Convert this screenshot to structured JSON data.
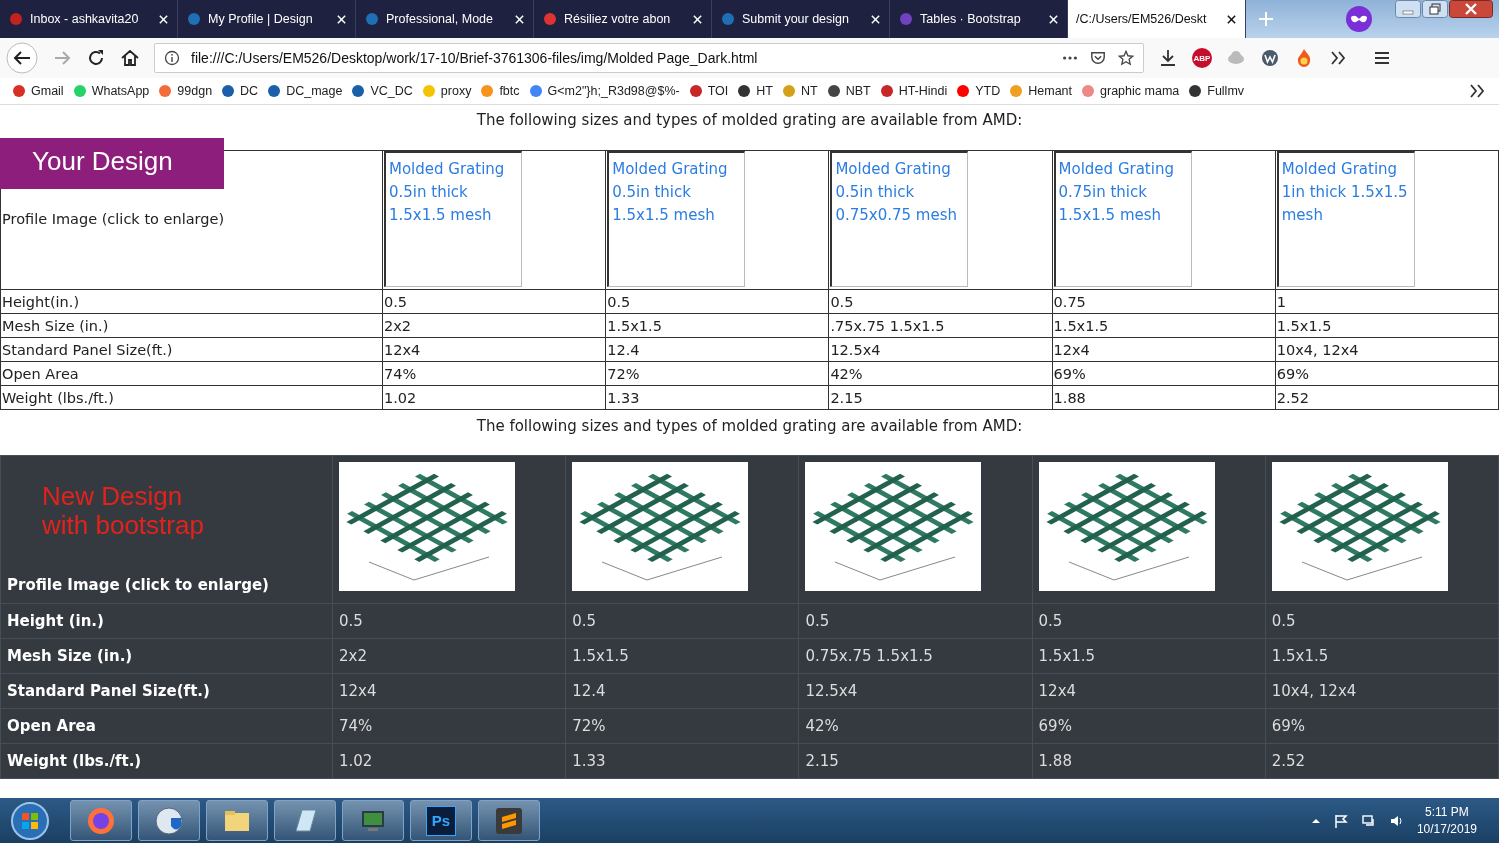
{
  "browser": {
    "tabs": [
      {
        "title": "Inbox - ashkavita20",
        "selected": false
      },
      {
        "title": "My Profile | Design",
        "selected": false
      },
      {
        "title": "Professional, Mode",
        "selected": false
      },
      {
        "title": "Résiliez votre abon",
        "selected": false
      },
      {
        "title": "Submit your design",
        "selected": false
      },
      {
        "title": "Tables · Bootstrap",
        "selected": false
      },
      {
        "title": "/C:/Users/EM526/Deskt",
        "selected": true
      }
    ],
    "forward_disabled": true,
    "address": "file:///C:/Users/EM526/Desktop/work/17-10/Brief-3761306-files/img/Molded Page_Dark.html",
    "extension_badge": "ABP",
    "bookmarks": [
      "Gmail",
      "WhatsApp",
      "99dgn",
      "DC",
      "DC_mage",
      "VC_DC",
      "proxy",
      "fbtc",
      "G<m2\"}h;_R3d98@$%-",
      "TOI",
      "HT",
      "NT",
      "NBT",
      "HT-Hindi",
      "YTD",
      "Hemant",
      "graphic mama",
      "Fullmv"
    ]
  },
  "page": {
    "caption_top": "The following sizes and types of molded grating are available from AMD:",
    "legacy_table": {
      "badge": "Your Design",
      "header_label": "Profile Image (click to enlarge)",
      "products": [
        "Molded Grating 0.5in thick 1.5x1.5 mesh",
        "Molded Grating 0.5in thick 1.5x1.5 mesh",
        "Molded Grating 0.5in thick 0.75x0.75 mesh",
        "Molded Grating 0.75in thick 1.5x1.5 mesh",
        "Molded Grating 1in thick 1.5x1.5 mesh"
      ],
      "rows": [
        {
          "label": "Height(in.)",
          "cells": [
            "0.5",
            "0.5",
            "0.5",
            "0.75",
            "1"
          ]
        },
        {
          "label": "Mesh Size (in.)",
          "cells": [
            "2x2",
            "1.5x1.5",
            ".75x.75 1.5x1.5",
            "1.5x1.5",
            "1.5x1.5"
          ]
        },
        {
          "label": "Standard Panel Size(ft.)",
          "cells": [
            "12x4",
            "12.4",
            "12.5x4",
            "12x4",
            "10x4, 12x4"
          ]
        },
        {
          "label": "Open Area",
          "cells": [
            "74%",
            "72%",
            "42%",
            "69%",
            "69%"
          ]
        },
        {
          "label": "Weight (lbs./ft.)",
          "cells": [
            "1.02",
            "1.33",
            "2.15",
            "1.88",
            "2.52"
          ]
        }
      ]
    },
    "caption_bottom": "The following sizes and types of molded grating are available from AMD:",
    "bootstrap_table": {
      "title": "New Design with bootstrap",
      "header_label": "Profile Image (click to enlarge)",
      "rows": [
        {
          "label": "Height (in.)",
          "cells": [
            "0.5",
            "0.5",
            "0.5",
            "0.5",
            "0.5"
          ]
        },
        {
          "label": "Mesh Size (in.)",
          "cells": [
            "2x2",
            "1.5x1.5",
            "0.75x.75 1.5x1.5",
            "1.5x1.5",
            "1.5x1.5"
          ]
        },
        {
          "label": "Standard Panel Size(ft.)",
          "cells": [
            "12x4",
            "12.4",
            "12.5x4",
            "12x4",
            "10x4, 12x4"
          ]
        },
        {
          "label": "Open Area",
          "cells": [
            "74%",
            "72%",
            "42%",
            "69%",
            "69%"
          ]
        },
        {
          "label": "Weight (lbs./ft.)",
          "cells": [
            "1.02",
            "1.33",
            "2.15",
            "1.88",
            "2.52"
          ]
        }
      ]
    }
  },
  "taskbar": {
    "photoshop_label": "Ps",
    "time": "5:11 PM",
    "date": "10/17/2019"
  }
}
